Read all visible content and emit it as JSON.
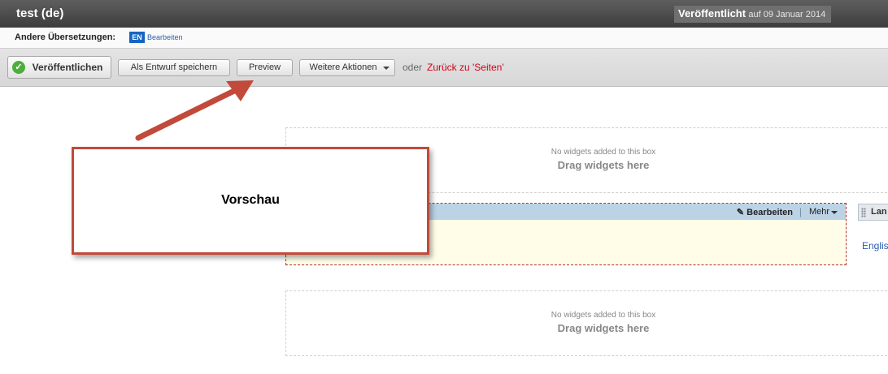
{
  "header": {
    "title": "test (de)",
    "status": "Veröffentlicht",
    "status_date": "auf 09 Januar 2014"
  },
  "translations": {
    "label": "Andere Übersetzungen:",
    "lang": "EN",
    "edit_label": "Bearbeiten"
  },
  "toolbar": {
    "publish_label": "Veröffentlichen",
    "save_draft_label": "Als Entwurf speichern",
    "preview_label": "Preview",
    "more_actions_label": "Weitere Aktionen",
    "or_text": "oder",
    "back_link": "Zurück zu 'Seiten'"
  },
  "dropzones": [
    {
      "empty_text": "No widgets added to this box",
      "hint": "Drag widgets here"
    },
    {
      "empty_text": "No widgets added to this box",
      "hint": "Drag widgets here"
    }
  ],
  "widget": {
    "edit_label": "Bearbeiten",
    "more_label": "Mehr"
  },
  "side_widget": {
    "title": "Lan",
    "link": "Englis"
  },
  "annotation": {
    "text": "Vorschau"
  },
  "colors": {
    "title_bar": "#4a4a4a",
    "accent_red": "#c14a3a",
    "link_blue": "#2a5db0",
    "back_link_red": "#d0021b",
    "lang_badge": "#1565c0"
  },
  "icons": {
    "publish": "check-circle-icon",
    "edit": "pencil-icon",
    "caret": "chevron-down-icon",
    "grip": "drag-handle-icon"
  }
}
